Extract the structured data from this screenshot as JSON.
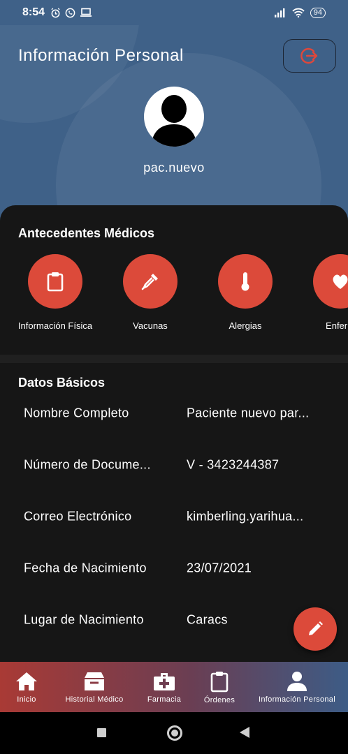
{
  "status_bar": {
    "time": "8:54",
    "battery": "94"
  },
  "header": {
    "title": "Información Personal",
    "username": "pac.nuevo"
  },
  "antecedentes": {
    "title": "Antecedentes Médicos",
    "items": [
      {
        "label": "Información Física",
        "icon": "clipboard-icon"
      },
      {
        "label": "Vacunas",
        "icon": "syringe-icon"
      },
      {
        "label": "Alergias",
        "icon": "thermometer-icon"
      },
      {
        "label": "Enferm",
        "icon": "heart-icon"
      }
    ]
  },
  "datos_basicos": {
    "title": "Datos Básicos",
    "rows": [
      {
        "label": "Nombre Completo",
        "value": "Paciente nuevo par..."
      },
      {
        "label": "Número de Docume...",
        "value": "V - 3423244387"
      },
      {
        "label": "Correo Electrónico",
        "value": "kimberling.yarihua..."
      },
      {
        "label": "Fecha de Nacimiento",
        "value": "23/07/2021"
      },
      {
        "label": "Lugar de Nacimiento",
        "value": "Caracs"
      }
    ]
  },
  "bottom_nav": [
    {
      "label": "Inicio",
      "icon": "home-icon"
    },
    {
      "label": "Historial Médico",
      "icon": "inbox-icon"
    },
    {
      "label": "Farmacia",
      "icon": "medical-kit-icon"
    },
    {
      "label": "Órdenes",
      "icon": "clipboard-icon"
    },
    {
      "label": "Información Personal",
      "icon": "person-icon"
    }
  ],
  "colors": {
    "accent": "#dc4a3a",
    "header_bg": "#3f6188",
    "sheet_bg": "#161616"
  }
}
